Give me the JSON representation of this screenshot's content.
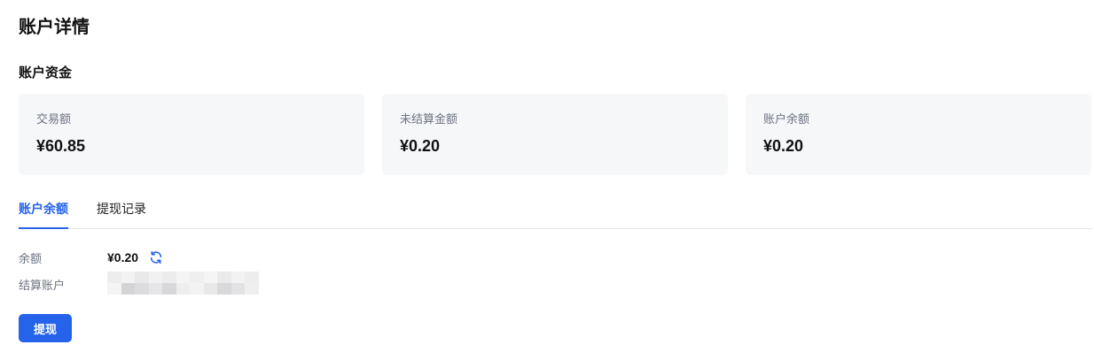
{
  "page": {
    "title": "账户详情"
  },
  "funds": {
    "section_title": "账户资金",
    "cards": [
      {
        "label": "交易额",
        "value": "¥60.85"
      },
      {
        "label": "未结算金额",
        "value": "¥0.20"
      },
      {
        "label": "账户余额",
        "value": "¥0.20"
      }
    ]
  },
  "tabs": [
    {
      "label": "账户余额",
      "active": true
    },
    {
      "label": "提现记录",
      "active": false
    }
  ],
  "balance": {
    "label": "余额",
    "value": "¥0.20",
    "refresh_icon": "refresh-icon"
  },
  "settlement": {
    "label": "结算账户",
    "value_state": "redacted"
  },
  "actions": {
    "withdraw_label": "提现"
  },
  "colors": {
    "accent": "#2563eb",
    "card_bg": "#f6f7f9",
    "muted_text": "#6b7280"
  }
}
